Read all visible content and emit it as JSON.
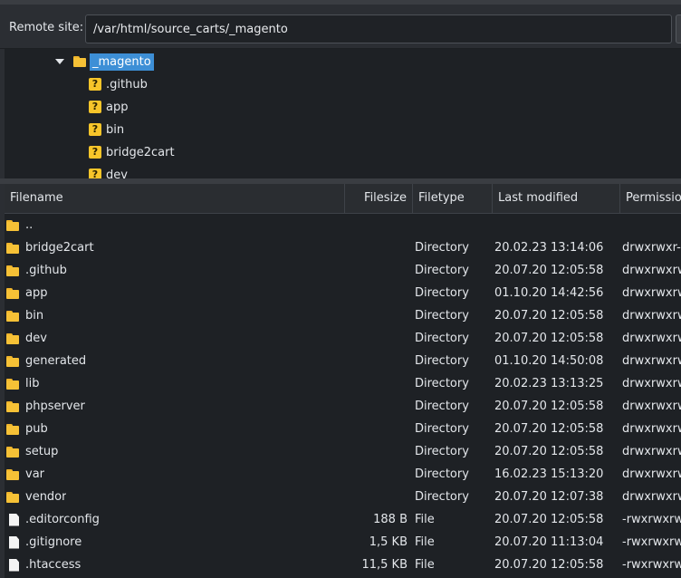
{
  "remote": {
    "label": "Remote site:",
    "path": "/var/html/source_carts/_magento"
  },
  "tree": {
    "root": {
      "label": "_magento",
      "icon": "folder-open-icon"
    },
    "children": [
      {
        "label": ".github",
        "icon": "unknown-folder-icon"
      },
      {
        "label": "app",
        "icon": "unknown-folder-icon"
      },
      {
        "label": "bin",
        "icon": "unknown-folder-icon"
      },
      {
        "label": "bridge2cart",
        "icon": "unknown-folder-icon"
      },
      {
        "label": "dev",
        "icon": "unknown-folder-icon"
      }
    ]
  },
  "list": {
    "columns": {
      "filename": "Filename",
      "filesize": "Filesize",
      "filetype": "Filetype",
      "modified": "Last modified",
      "permissions": "Permissio"
    },
    "rows": [
      {
        "icon": "folder",
        "name": "..",
        "size": "",
        "type": "",
        "modified": "",
        "perm": ""
      },
      {
        "icon": "folder",
        "name": "bridge2cart",
        "size": "",
        "type": "Directory",
        "modified": "20.02.23 13:14:06",
        "perm": "drwxrwxr-"
      },
      {
        "icon": "folder",
        "name": ".github",
        "size": "",
        "type": "Directory",
        "modified": "20.07.20 12:05:58",
        "perm": "drwxrwxrw"
      },
      {
        "icon": "folder",
        "name": "app",
        "size": "",
        "type": "Directory",
        "modified": "01.10.20 14:42:56",
        "perm": "drwxrwxrw"
      },
      {
        "icon": "folder",
        "name": "bin",
        "size": "",
        "type": "Directory",
        "modified": "20.07.20 12:05:58",
        "perm": "drwxrwxrw"
      },
      {
        "icon": "folder",
        "name": "dev",
        "size": "",
        "type": "Directory",
        "modified": "20.07.20 12:05:58",
        "perm": "drwxrwxrw"
      },
      {
        "icon": "folder",
        "name": "generated",
        "size": "",
        "type": "Directory",
        "modified": "01.10.20 14:50:08",
        "perm": "drwxrwxrw"
      },
      {
        "icon": "folder",
        "name": "lib",
        "size": "",
        "type": "Directory",
        "modified": "20.02.23 13:13:25",
        "perm": "drwxrwxrw"
      },
      {
        "icon": "folder",
        "name": "phpserver",
        "size": "",
        "type": "Directory",
        "modified": "20.07.20 12:05:58",
        "perm": "drwxrwxrw"
      },
      {
        "icon": "folder",
        "name": "pub",
        "size": "",
        "type": "Directory",
        "modified": "20.07.20 12:05:58",
        "perm": "drwxrwxrw"
      },
      {
        "icon": "folder",
        "name": "setup",
        "size": "",
        "type": "Directory",
        "modified": "20.07.20 12:05:58",
        "perm": "drwxrwxrw"
      },
      {
        "icon": "folder",
        "name": "var",
        "size": "",
        "type": "Directory",
        "modified": "16.02.23 15:13:20",
        "perm": "drwxrwxrw"
      },
      {
        "icon": "folder",
        "name": "vendor",
        "size": "",
        "type": "Directory",
        "modified": "20.07.20 12:07:38",
        "perm": "drwxrwxrw"
      },
      {
        "icon": "file",
        "name": ".editorconfig",
        "size": "188 B",
        "type": "File",
        "modified": "20.07.20 12:05:58",
        "perm": "-rwxrwxrw"
      },
      {
        "icon": "file",
        "name": ".gitignore",
        "size": "1,5 KB",
        "type": "File",
        "modified": "20.07.20 11:13:04",
        "perm": "-rwxrwxrw"
      },
      {
        "icon": "file",
        "name": ".htaccess",
        "size": "11,5 KB",
        "type": "File",
        "modified": "20.07.20 12:05:58",
        "perm": "-rwxrwxrw"
      }
    ]
  },
  "colors": {
    "background": "#1e2125",
    "selection": "#3d8fd6",
    "folder": "#f6c136"
  }
}
